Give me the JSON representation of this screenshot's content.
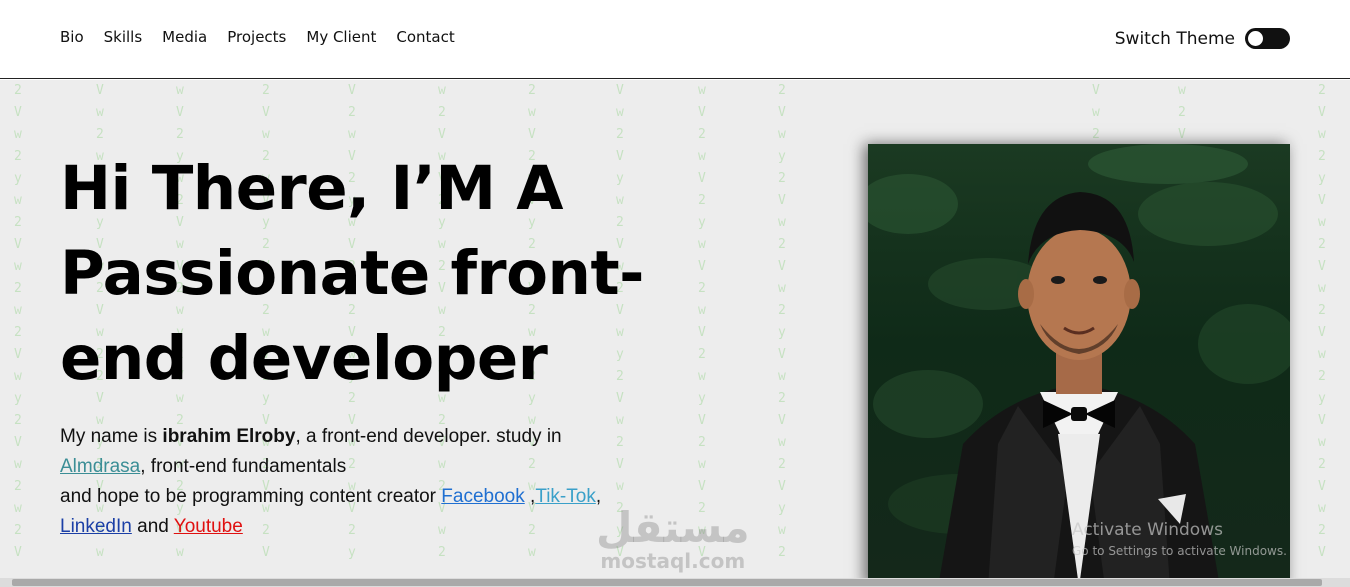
{
  "nav": {
    "links": [
      "Bio",
      "Skills",
      "Media",
      "Projects",
      "My Client",
      "Contact"
    ]
  },
  "theme": {
    "label": "Switch Theme"
  },
  "hero": {
    "heading": "Hi There, I’M A Passionate front-end developer",
    "text": {
      "p1": "My name is ",
      "name": "ibrahim Elroby",
      "p2": ", a front-end developer. study in ",
      "almdrasa": "Almdrasa",
      "p3": ", front-end fundamentals",
      "p4": "and hope to be programming content creator ",
      "facebook": "Facebook",
      "p5": " ,",
      "tiktok": "Tik-Tok",
      "p6": ",",
      "linkedin": "LinkedIn",
      "p7": " and ",
      "youtube": "Youtube"
    }
  },
  "photo": {
    "alt": "profile-photo"
  },
  "watermark": {
    "main": "مستقل",
    "sub": "mostaql.com"
  },
  "activate_windows": {
    "title": "Activate Windows",
    "subtitle": "Go to Settings to activate Windows."
  },
  "colors": {
    "matrix": "#a8d9a0",
    "link_teal": "#3b8e96",
    "link_blue": "#1f6fd1",
    "link_red": "#e01010"
  }
}
